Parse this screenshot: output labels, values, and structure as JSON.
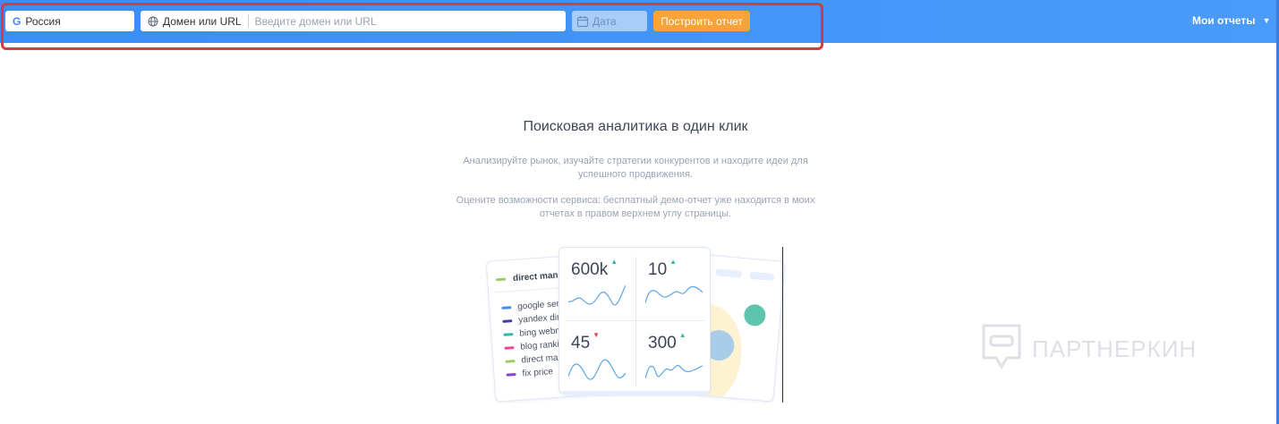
{
  "toolbar": {
    "region": {
      "label": "Россия",
      "icon": "google-icon",
      "icon_glyph": "G"
    },
    "domain": {
      "label": "Домен или URL",
      "icon": "globe-icon",
      "placeholder": "Введите домен или URL",
      "value": ""
    },
    "date": {
      "label": "Дата",
      "icon": "calendar-icon"
    },
    "build_label": "Построить отчет",
    "my_reports_label": "Мои отчеты",
    "my_reports_caret": "▼"
  },
  "main": {
    "title": "Поисковая аналитика в один клик",
    "paragraph1": "Анализируйте рынок, изучайте стратегии конкурентов и находите идеи для успешного продвижения.",
    "paragraph2": "Оцените возможности сервиса: бесплатный демо-отчет уже находится в моих отчетах в правом верхнем углу страницы."
  },
  "illustration": {
    "left_card": {
      "header": "direct mana",
      "items": [
        {
          "label": "google serp",
          "color": "#4a90e2"
        },
        {
          "label": "yandex dire",
          "color": "#3f3fa8"
        },
        {
          "label": "bing webm",
          "color": "#3bb3a8"
        },
        {
          "label": "blog rankin",
          "color": "#e8499a"
        },
        {
          "label": "direct mana",
          "color": "#9ccc65"
        },
        {
          "label": "fix price",
          "color": "#8e3fd6"
        }
      ]
    },
    "metrics": [
      {
        "value": "600k",
        "trend": "up",
        "arrow": "▲"
      },
      {
        "value": "10",
        "trend": "up",
        "arrow": "▲"
      },
      {
        "value": "45",
        "trend": "down",
        "arrow": "▼"
      },
      {
        "value": "300",
        "trend": "up",
        "arrow": "▲"
      }
    ]
  },
  "watermark": {
    "text": "ПАРТНЕРКИН"
  },
  "colors": {
    "topbar": "#4596f8",
    "accent_orange": "#f7a338",
    "highlight_red": "#d93a3a",
    "trend_up": "#3bb3a0",
    "trend_down": "#e04848",
    "sparkline": "#5aa6e6"
  }
}
